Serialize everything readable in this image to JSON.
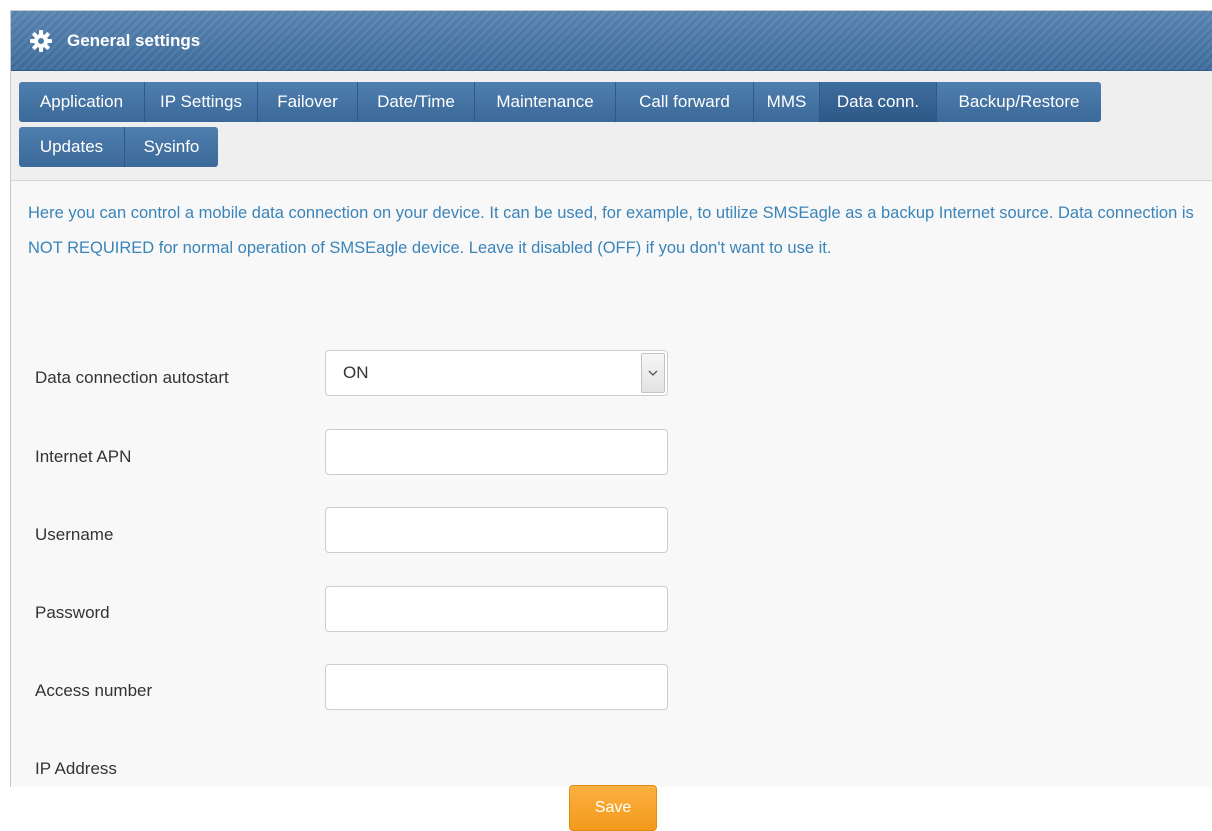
{
  "header": {
    "title": "General settings",
    "icon": "gear-icon"
  },
  "tabs": {
    "row1": [
      {
        "label": "Application",
        "active": false
      },
      {
        "label": "IP Settings",
        "active": false
      },
      {
        "label": "Failover",
        "active": false
      },
      {
        "label": "Date/Time",
        "active": false
      },
      {
        "label": "Maintenance",
        "active": false
      },
      {
        "label": "Call forward",
        "active": false
      },
      {
        "label": "MMS",
        "active": false
      },
      {
        "label": "Data conn.",
        "active": true
      },
      {
        "label": "Backup/Restore",
        "active": false
      }
    ],
    "row2": [
      {
        "label": "Updates",
        "active": false
      },
      {
        "label": "Sysinfo",
        "active": false
      }
    ]
  },
  "intro_text": "Here you can control a mobile data connection on your device. It can be used, for example, to utilize SMSEagle as a backup Internet source. Data connection is NOT REQUIRED for normal operation of SMSEagle device. Leave it disabled (OFF) if you don't want to use it.",
  "form": {
    "autostart": {
      "label": "Data connection autostart",
      "value": "ON"
    },
    "apn": {
      "label": "Internet APN",
      "value": ""
    },
    "username": {
      "label": "Username",
      "value": ""
    },
    "password": {
      "label": "Password",
      "value": ""
    },
    "access_number": {
      "label": "Access number",
      "value": ""
    },
    "ip_address": {
      "label": "IP Address",
      "value": ""
    },
    "save_label": "Save"
  },
  "colors": {
    "header_bg": "#4a7aab",
    "tab_bg": "#4677a8",
    "tab_active_bg": "#2f5a88",
    "intro_text": "#3a84b9",
    "save_button": "#f7a52e"
  }
}
